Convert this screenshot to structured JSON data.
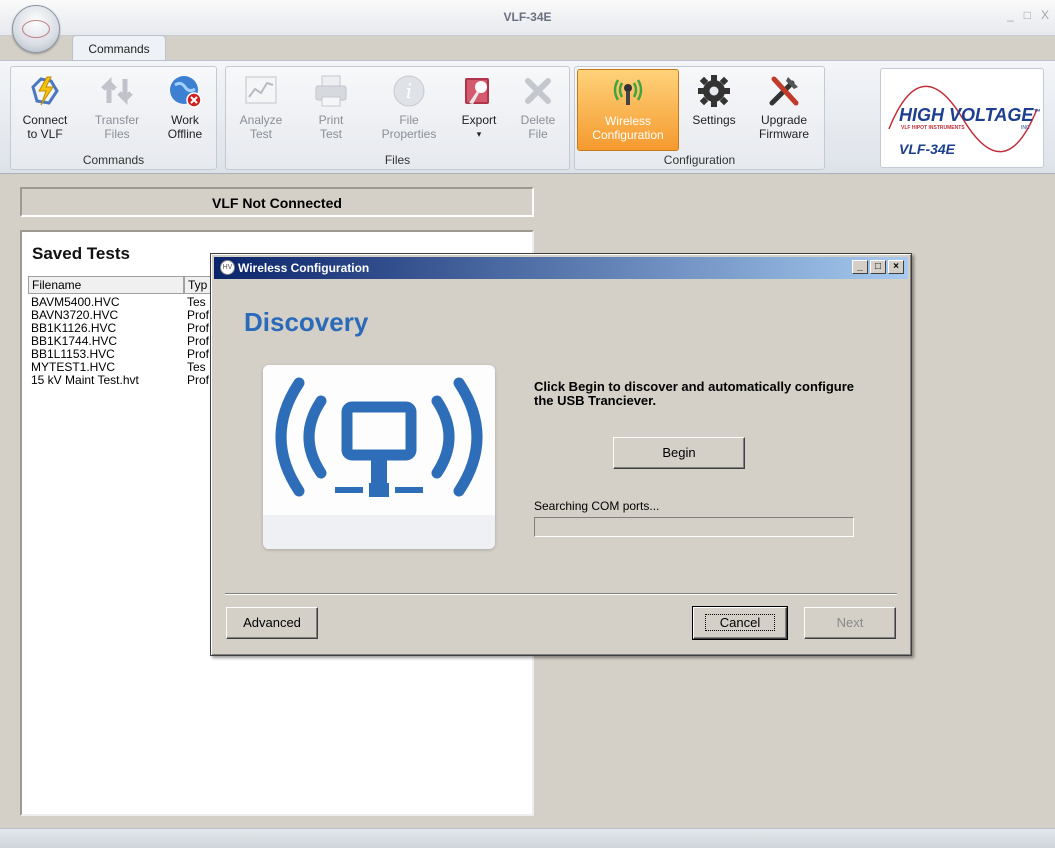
{
  "window": {
    "title": "VLF-34E",
    "controls": [
      "_",
      "□",
      "X"
    ]
  },
  "tabs": [
    {
      "label": "Commands"
    }
  ],
  "ribbon": {
    "groups": [
      {
        "label": "Commands",
        "buttons": [
          {
            "label": "Connect to VLF",
            "line1": "Connect",
            "line2": "to VLF",
            "icon": "lightning-icon",
            "enabled": true
          },
          {
            "label": "Transfer Files",
            "line1": "Transfer",
            "line2": "Files",
            "icon": "transfer-icon",
            "enabled": false
          },
          {
            "label": "Work Offline",
            "line1": "Work",
            "line2": "Offline",
            "icon": "globe-icon",
            "enabled": true
          }
        ]
      },
      {
        "label": "Files",
        "buttons": [
          {
            "label": "Analyze Test",
            "line1": "Analyze",
            "line2": "Test",
            "icon": "chart-icon",
            "enabled": false
          },
          {
            "label": "Print Test",
            "line1": "Print",
            "line2": "Test",
            "icon": "printer-icon",
            "enabled": false
          },
          {
            "label": "File Properties",
            "line1": "File",
            "line2": "Properties",
            "icon": "info-icon",
            "enabled": false
          },
          {
            "label": "Export",
            "line1": "Export",
            "line2": "▾",
            "icon": "export-icon",
            "enabled": true
          },
          {
            "label": "Delete File",
            "line1": "Delete",
            "line2": "File",
            "icon": "delete-icon",
            "enabled": false
          }
        ]
      },
      {
        "label": "Configuration",
        "buttons": [
          {
            "label": "Wireless Configuration",
            "line1": "Wireless",
            "line2": "Configuration",
            "icon": "wireless-icon",
            "enabled": true,
            "active": true
          },
          {
            "label": "Settings",
            "line1": "Settings",
            "line2": "",
            "icon": "gear-icon",
            "enabled": true
          },
          {
            "label": "Upgrade Firmware",
            "line1": "Upgrade",
            "line2": "Firmware",
            "icon": "tools-icon",
            "enabled": true
          }
        ]
      }
    ]
  },
  "logo": {
    "brand": "HIGH VOLTAGE",
    "tm": "™",
    "sub": "VLF HIPOT INSTRUMENTS",
    "inc": "INC",
    "model": "VLF-34E"
  },
  "status": {
    "text": "VLF Not Connected"
  },
  "saved_tests": {
    "title": "Saved Tests",
    "columns": [
      "Filename",
      "Typ"
    ],
    "rows": [
      [
        "BAVM5400.HVC",
        "Tes"
      ],
      [
        "BAVN3720.HVC",
        "Prof"
      ],
      [
        "BB1K1126.HVC",
        "Prof"
      ],
      [
        "BB1K1744.HVC",
        "Prof"
      ],
      [
        "BB1L1153.HVC",
        "Prof"
      ],
      [
        "MYTEST1.HVC",
        "Tes"
      ],
      [
        "15 kV Maint Test.hvt",
        "Prof"
      ]
    ]
  },
  "dialog": {
    "title": "Wireless Configuration",
    "icon_text": "HV",
    "heading": "Discovery",
    "instructions": "Click Begin to discover and automatically configure the USB Tranciever.",
    "begin_label": "Begin",
    "status_text": "Searching COM ports...",
    "progress": 0,
    "advanced_label": "Advanced",
    "cancel_label": "Cancel",
    "next_label": "Next",
    "colors": {
      "accent": "#2a6ab8",
      "titlebar_start": "#0a246a",
      "titlebar_end": "#a6caf0"
    }
  }
}
